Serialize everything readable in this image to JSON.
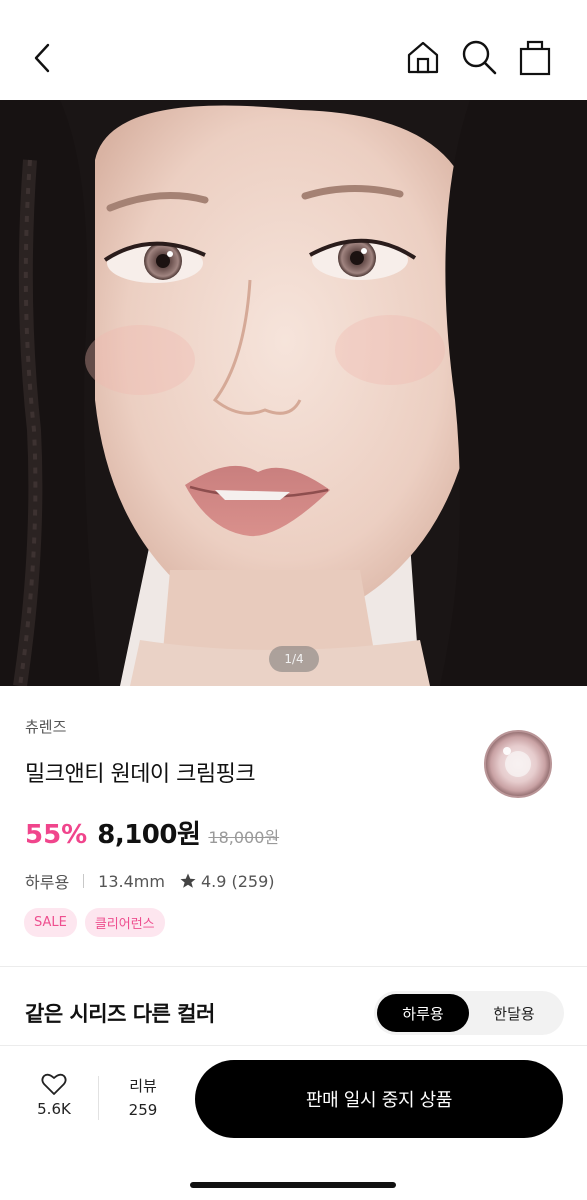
{
  "header": {
    "back_icon": "chevron-left-icon",
    "home_icon": "home-icon",
    "search_icon": "search-icon",
    "cart_icon": "shopping-bag-icon"
  },
  "hero": {
    "pager": "1/4"
  },
  "product": {
    "brand": "츄렌즈",
    "name": "밀크앤티 원데이 크림핑크",
    "discount": "55%",
    "price": "8,100원",
    "original_price": "18,000원",
    "usage": "하루용",
    "diameter": "13.4mm",
    "rating": "4.9 (259)",
    "tags": [
      "SALE",
      "클리어런스"
    ]
  },
  "series": {
    "title": "같은 시리즈 다른 컬러",
    "options": [
      "하루용",
      "한달용"
    ],
    "selected": "하루용"
  },
  "bottom_bar": {
    "like_count": "5.6K",
    "review_label": "리뷰",
    "review_count": "259",
    "cta_label": "판매 일시 중지 상품"
  },
  "colors": {
    "accent_pink": "#f0458c",
    "tag_bg": "#fde6ef",
    "cta_bg": "#000000"
  }
}
